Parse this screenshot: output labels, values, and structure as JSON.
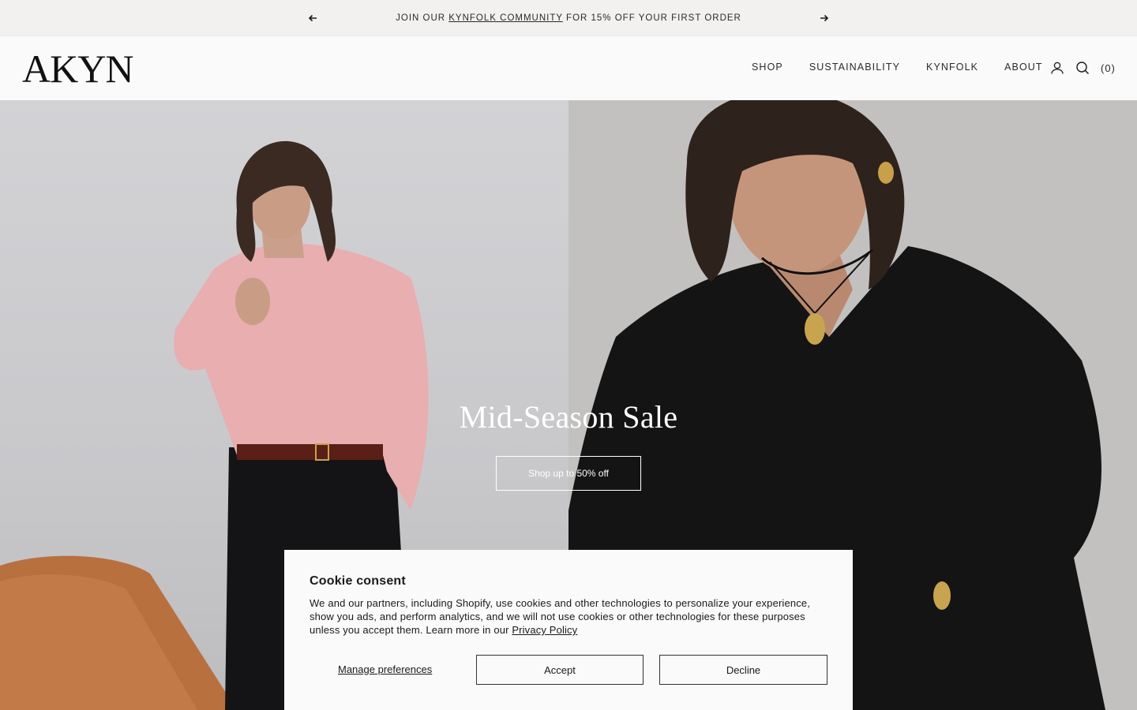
{
  "announcement": {
    "prefix": "JOIN OUR ",
    "link": "KYNFOLK COMMUNITY",
    "suffix": " FOR 15% OFF YOUR FIRST ORDER",
    "prev_icon": "arrow-left-icon",
    "next_icon": "arrow-right-icon"
  },
  "header": {
    "logo": "AKYN",
    "nav": [
      "SHOP",
      "SUSTAINABILITY",
      "KYNFOLK",
      "ABOUT"
    ],
    "icons": [
      "user-icon",
      "search-icon"
    ],
    "cart": "(0)"
  },
  "hero": {
    "title": "Mid-Season Sale",
    "button": "Shop up to 50% off"
  },
  "cookie": {
    "title": "Cookie consent",
    "body": "We and our partners, including Shopify, use cookies and other technologies to personalize your experience, show you ads, and perform analytics, and we will not use cookies or other technologies for these purposes unless you accept them. Learn more in our ",
    "policy_link": "Privacy Policy",
    "manage": "Manage preferences",
    "accept": "Accept",
    "decline": "Decline"
  },
  "colors": {
    "announcement_bg": "#f2f1ef",
    "page_bg": "#fafafa",
    "text": "#1a1a1a"
  }
}
